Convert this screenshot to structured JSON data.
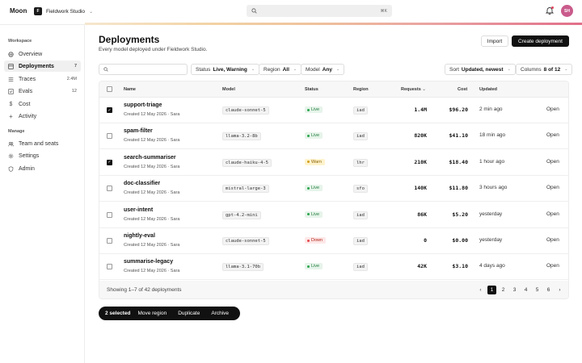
{
  "topbar": {
    "brand": "Moon",
    "org_logo": "F",
    "org_name": "Fieldwork Studio",
    "search_shortcut": "⌘K",
    "avatar_initials": "SH"
  },
  "sidebar": {
    "workspace_label": "Workspace",
    "manage_label": "Manage",
    "items": [
      {
        "label": "Overview",
        "icon": "globe-icon",
        "count": ""
      },
      {
        "label": "Deployments",
        "icon": "grid-icon",
        "count": "7",
        "active": true
      },
      {
        "label": "Traces",
        "icon": "list-icon",
        "count": "2.4M"
      },
      {
        "label": "Evals",
        "icon": "check-square-icon",
        "count": "12"
      },
      {
        "label": "Cost",
        "icon": "dollar-icon",
        "count": ""
      },
      {
        "label": "Activity",
        "icon": "plus-icon",
        "count": ""
      }
    ],
    "manage_items": [
      {
        "label": "Team and seats",
        "icon": "people-icon"
      },
      {
        "label": "Settings",
        "icon": "gear-icon"
      },
      {
        "label": "Admin",
        "icon": "shield-icon"
      }
    ]
  },
  "header": {
    "title": "Deployments",
    "subtitle": "Every model deployed under Fieldwork Studio.",
    "import_label": "Import",
    "create_label": "Create deployment"
  },
  "filters": {
    "status_label": "Status",
    "status_value": "Live, Warning",
    "region_label": "Region",
    "region_value": "All",
    "model_label": "Model",
    "model_value": "Any",
    "sort_label": "Sort",
    "sort_value": "Updated, newest",
    "columns_label": "Columns",
    "columns_value": "8 of 12"
  },
  "table": {
    "headers": {
      "name": "Name",
      "model": "Model",
      "status": "Status",
      "region": "Region",
      "requests": "Requests",
      "cost": "Cost",
      "updated": "Updated"
    },
    "rows": [
      {
        "name": "support-triage",
        "created": "Created 12 May 2026 · Sara",
        "model": "claude-sonnet-5",
        "status": "Live",
        "region": "iad",
        "requests": "1.4M",
        "cost": "$96.20",
        "updated": "2 min ago",
        "action": "Open",
        "checked": true
      },
      {
        "name": "spam-filter",
        "created": "Created 12 May 2026 · Sara",
        "model": "llama-3.2-8b",
        "status": "Live",
        "region": "iad",
        "requests": "820K",
        "cost": "$41.10",
        "updated": "18 min ago",
        "action": "Open",
        "checked": false
      },
      {
        "name": "search-summariser",
        "created": "Created 12 May 2026 · Sara",
        "model": "claude-haiku-4-5",
        "status": "Warn",
        "region": "lhr",
        "requests": "210K",
        "cost": "$18.40",
        "updated": "1 hour ago",
        "action": "Open",
        "checked": true
      },
      {
        "name": "doc-classifier",
        "created": "Created 12 May 2026 · Sara",
        "model": "mistral-large-3",
        "status": "Live",
        "region": "sfo",
        "requests": "140K",
        "cost": "$11.80",
        "updated": "3 hours ago",
        "action": "Open",
        "checked": false
      },
      {
        "name": "user-intent",
        "created": "Created 12 May 2026 · Sara",
        "model": "gpt-4.2-mini",
        "status": "Live",
        "region": "iad",
        "requests": "86K",
        "cost": "$5.20",
        "updated": "yesterday",
        "action": "Open",
        "checked": false
      },
      {
        "name": "nightly-eval",
        "created": "Created 12 May 2026 · Sara",
        "model": "claude-sonnet-5",
        "status": "Down",
        "region": "iad",
        "requests": "0",
        "cost": "$0.00",
        "updated": "yesterday",
        "action": "Open",
        "checked": false
      },
      {
        "name": "summarise-legacy",
        "created": "Created 12 May 2026 · Sara",
        "model": "llama-3.1-70b",
        "status": "Live",
        "region": "iad",
        "requests": "42K",
        "cost": "$3.10",
        "updated": "4 days ago",
        "action": "Open",
        "checked": false
      }
    ],
    "footer": "Showing 1–7 of 42 deployments",
    "pages": [
      "1",
      "2",
      "3",
      "4",
      "5",
      "6"
    ],
    "current_page": "1"
  },
  "actionbar": {
    "selected": "2 selected",
    "move": "Move region",
    "duplicate": "Duplicate",
    "archive": "Archive"
  },
  "colors": {
    "accent": "#111111",
    "live": "#2da44e",
    "warn": "#d4a017",
    "down": "#e5484d",
    "avatar": "#c95b8b"
  }
}
